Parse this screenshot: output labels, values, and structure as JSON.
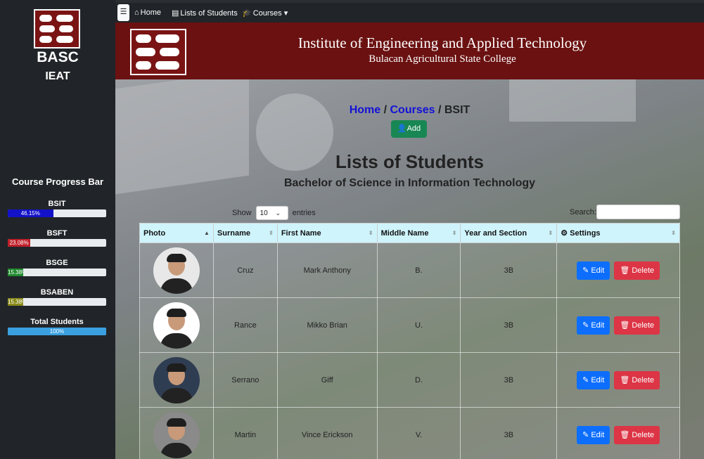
{
  "sidebar": {
    "brand": "BASC",
    "sub": "IEAT",
    "progress_title": "Course Progress Bar",
    "courses": [
      {
        "name": "BSIT",
        "percent_text": "46.15%",
        "percent": 46.15,
        "color": "#1412c9"
      },
      {
        "name": "BSFT",
        "percent_text": "23.08%",
        "percent": 23.08,
        "color": "#c01f2a"
      },
      {
        "name": "BSGE",
        "percent_text": "15.38%",
        "percent": 15.38,
        "color": "#1f8a2e"
      },
      {
        "name": "BSABEN",
        "percent_text": "15.38%",
        "percent": 15.38,
        "color": "#8a8a1a"
      },
      {
        "name": "Total Students",
        "percent_text": "100%",
        "percent": 100,
        "color": "#3aa0e0"
      }
    ]
  },
  "nav": {
    "toggle": "☰",
    "home": "Home",
    "lists": "Lists of Students",
    "courses": "Courses"
  },
  "header": {
    "title": "Institute of Engineering and Applied Technology",
    "subtitle": "Bulacan Agricultural State College"
  },
  "breadcrumb": {
    "home": "Home",
    "sep1": " / ",
    "courses": "Courses",
    "sep2": " / ",
    "current": "BSIT"
  },
  "add_label": "Add",
  "page_title": "Lists of Students",
  "page_subtitle": "Bachelor of Science in Information Technology",
  "table_controls": {
    "show": "Show",
    "entries_value": "10",
    "entries": "entries",
    "search": "Search:"
  },
  "table": {
    "headers": [
      "Photo",
      "Surname",
      "First Name",
      "Middle Name",
      "Year and Section",
      "Settings"
    ],
    "rows": [
      {
        "surname": "Cruz",
        "first": "Mark Anthony",
        "middle": "B.",
        "section": "3B"
      },
      {
        "surname": "Rance",
        "first": "Mikko Brian",
        "middle": "U.",
        "section": "3B"
      },
      {
        "surname": "Serrano",
        "first": "Giff",
        "middle": "D.",
        "section": "3B"
      },
      {
        "surname": "Martin",
        "first": "Vince Erickson",
        "middle": "V.",
        "section": "3B"
      }
    ],
    "edit_label": "Edit",
    "delete_label": "Delete"
  }
}
